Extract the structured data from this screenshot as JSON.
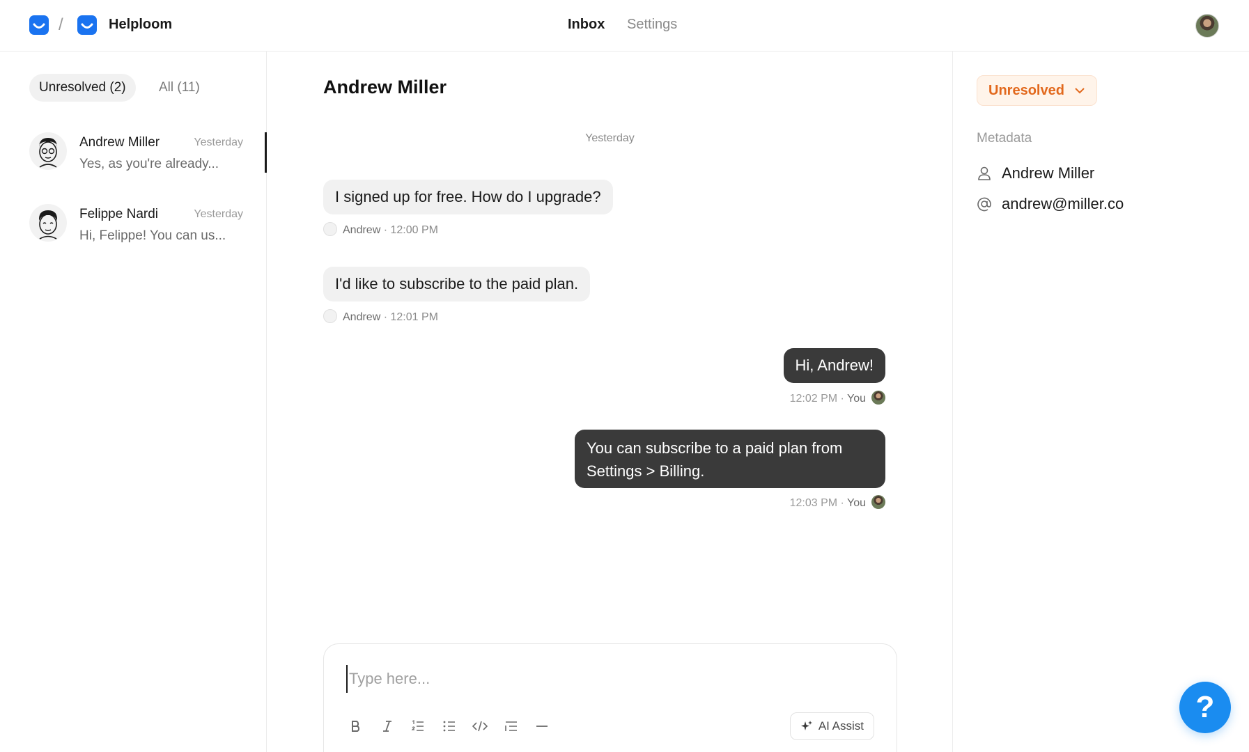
{
  "header": {
    "breadcrumb_sep": "/",
    "app_name": "Helploom",
    "nav": [
      {
        "label": "Inbox",
        "active": true
      },
      {
        "label": "Settings",
        "active": false
      }
    ],
    "accent_color": "#1a73f0"
  },
  "sidebar": {
    "filters": [
      {
        "label": "Unresolved (2)",
        "active": true
      },
      {
        "label": "All (11)",
        "active": false
      }
    ],
    "conversations": [
      {
        "name": "Andrew Miller",
        "time": "Yesterday",
        "preview": "Yes, as you're already...",
        "selected": true
      },
      {
        "name": "Felippe Nardi",
        "time": "Yesterday",
        "preview": "Hi, Felippe! You can us...",
        "selected": false
      }
    ]
  },
  "chat": {
    "title": "Andrew Miller",
    "day_separator": "Yesterday",
    "messages": [
      {
        "direction": "in",
        "text": "I signed up for free. How do I upgrade?",
        "author": "Andrew",
        "time": "12:00 PM"
      },
      {
        "direction": "in",
        "text": "I'd like to subscribe to the paid plan.",
        "author": "Andrew",
        "time": "12:01 PM"
      },
      {
        "direction": "out",
        "text": "Hi, Andrew!",
        "author": "You",
        "time": "12:02 PM"
      },
      {
        "direction": "out",
        "text_line1": "You can subscribe to a paid plan from",
        "text_line2": "Settings > Billing.",
        "author": "You",
        "time": "12:03 PM"
      }
    ],
    "meta_dot": "·",
    "composer": {
      "placeholder": "Type here...",
      "ai_assist_label": "AI Assist"
    }
  },
  "details": {
    "status": "Unresolved",
    "status_color": "#e2681c",
    "metadata_heading": "Metadata",
    "name": "Andrew Miller",
    "email": "andrew@miller.co"
  },
  "help": {
    "label": "?",
    "color": "#1a8cf0"
  }
}
